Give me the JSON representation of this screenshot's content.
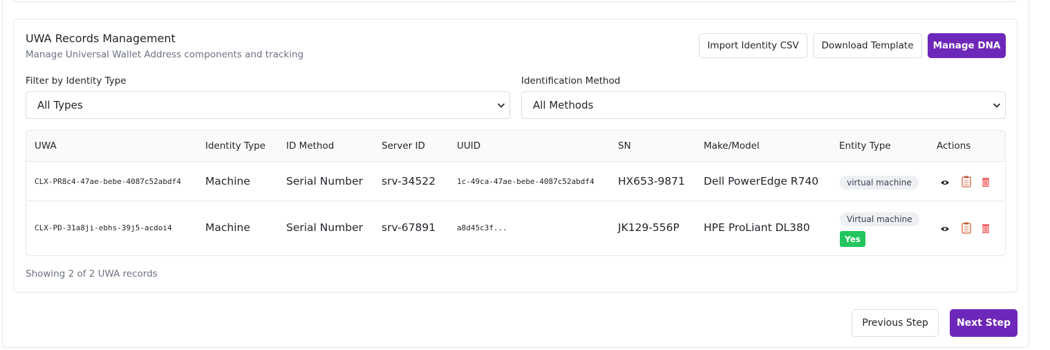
{
  "card": {
    "title": "UWA Records Management",
    "subtitle": "Manage Universal Wallet Address components and tracking"
  },
  "toolbar": {
    "import_label": "Import Identity CSV",
    "download_label": "Download Template",
    "manage_label": "Manage DNA"
  },
  "filters": {
    "identity_type_label": "Filter by Identity Type",
    "identity_type_value": "All Types",
    "method_label": "Identification Method",
    "method_value": "All Methods"
  },
  "table": {
    "headers": [
      "UWA",
      "Identity Type",
      "ID Method",
      "Server ID",
      "UUID",
      "SN",
      "Make/Model",
      "Entity Type",
      "Actions"
    ],
    "rows": [
      {
        "uwa": "CLX-PR8c4-47ae-bebe-4087c52abdf4",
        "identity_type": "Machine",
        "id_method": "Serial Number",
        "server_id": "srv-34522",
        "uuid": "1c-49ca-47ae-bebe-4087c52abdf4",
        "sn": "HX653-9871",
        "make_model": "Dell PowerEdge R740",
        "entity_type": "virtual machine"
      },
      {
        "uwa": "CLX-PD-31a8ji-ebhs-39j5-acdoi4",
        "identity_type": "Machine",
        "id_method": "Serial Number",
        "server_id": "srv-67891",
        "uuid": "a8d45c3f...",
        "sn": "JK129-556P",
        "make_model": "HPE ProLiant DL380",
        "entity_type": "Virtual machine",
        "entity_flag": "Yes"
      }
    ]
  },
  "footer": {
    "summary": "Showing 2 of 2 UWA records"
  },
  "nav": {
    "previous_label": "Previous Step",
    "next_label": "Next Step"
  },
  "colors": {
    "primary": "#6d28b9",
    "success": "#22c55e",
    "delete": "#ef4444",
    "copy": "#d97757"
  }
}
